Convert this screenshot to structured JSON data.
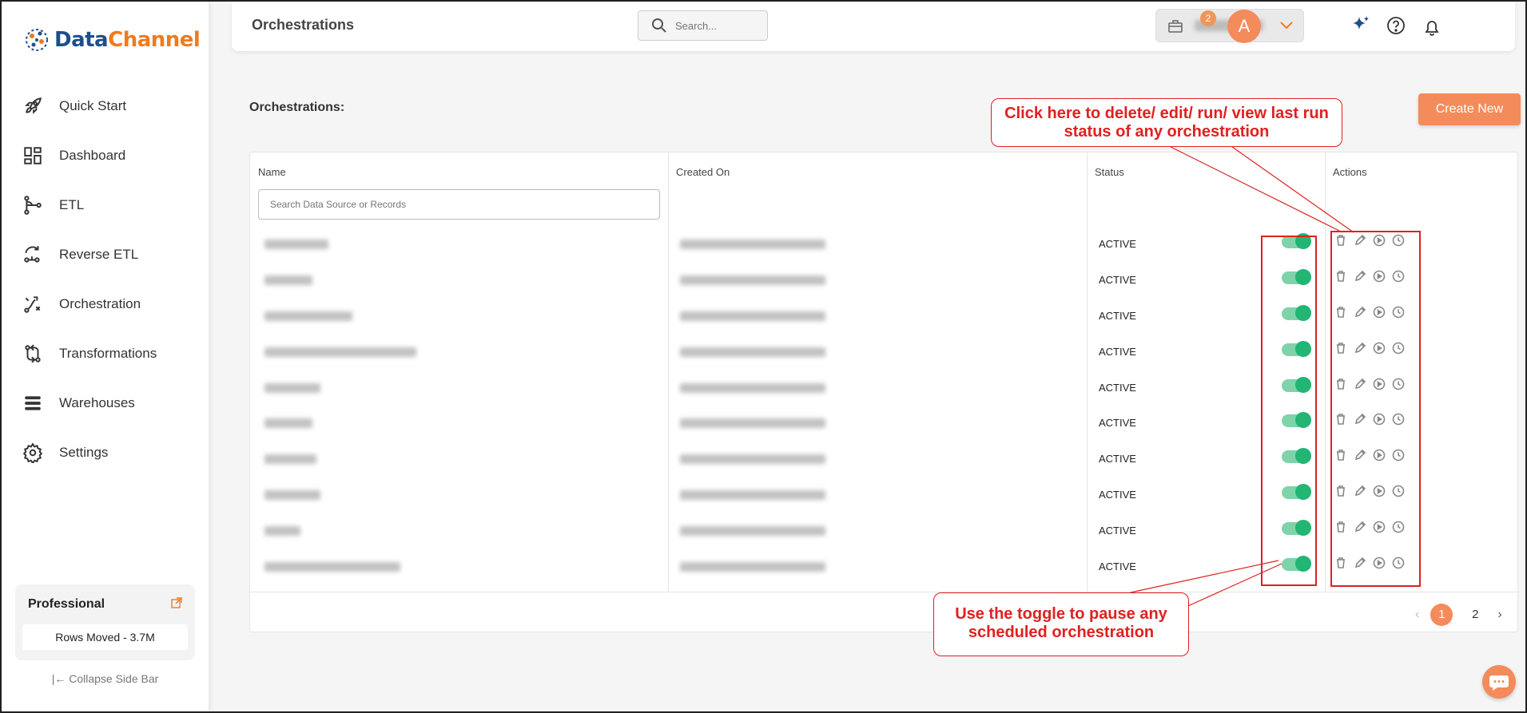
{
  "brand": {
    "part1": "Data",
    "part2": "Channel"
  },
  "sidebar": {
    "items": [
      {
        "label": "Quick Start",
        "icon": "rocket-icon"
      },
      {
        "label": "Dashboard",
        "icon": "dashboard-icon"
      },
      {
        "label": "ETL",
        "icon": "etl-icon"
      },
      {
        "label": "Reverse ETL",
        "icon": "reverse-etl-icon"
      },
      {
        "label": "Orchestration",
        "icon": "orchestration-icon"
      },
      {
        "label": "Transformations",
        "icon": "transformations-icon"
      },
      {
        "label": "Warehouses",
        "icon": "warehouses-icon"
      },
      {
        "label": "Settings",
        "icon": "gear-icon"
      }
    ],
    "plan": {
      "name": "Professional",
      "rows_moved": "Rows Moved - 3.7M"
    },
    "collapse_label": "|← Collapse Side Bar"
  },
  "header": {
    "title": "Orchestrations",
    "search_placeholder": "Search...",
    "notification_count": "2",
    "avatar_initial": "A"
  },
  "main": {
    "section_title": "Orchestrations:",
    "create_button": "Create New",
    "columns": {
      "name": "Name",
      "created_on": "Created On",
      "status": "Status",
      "actions": "Actions"
    },
    "filter_placeholder": "Search Data Source or Records",
    "rows": [
      {
        "status": "ACTIVE",
        "enabled": true
      },
      {
        "status": "ACTIVE",
        "enabled": true
      },
      {
        "status": "ACTIVE",
        "enabled": true
      },
      {
        "status": "ACTIVE",
        "enabled": true
      },
      {
        "status": "ACTIVE",
        "enabled": true
      },
      {
        "status": "ACTIVE",
        "enabled": true
      },
      {
        "status": "ACTIVE",
        "enabled": true
      },
      {
        "status": "ACTIVE",
        "enabled": true
      },
      {
        "status": "ACTIVE",
        "enabled": true
      },
      {
        "status": "ACTIVE",
        "enabled": true
      }
    ],
    "pagination": {
      "pages": [
        "1",
        "2"
      ],
      "current": "1",
      "prev": "‹",
      "next": "›"
    }
  },
  "annotations": {
    "actions_note": "Click here to delete/ edit/ run/ view last run status of any orchestration",
    "toggle_note": "Use the toggle to pause any scheduled orchestration"
  },
  "colors": {
    "accent": "#f48b5b",
    "toggle_on": "#22b573",
    "annotation": "#e02020"
  }
}
